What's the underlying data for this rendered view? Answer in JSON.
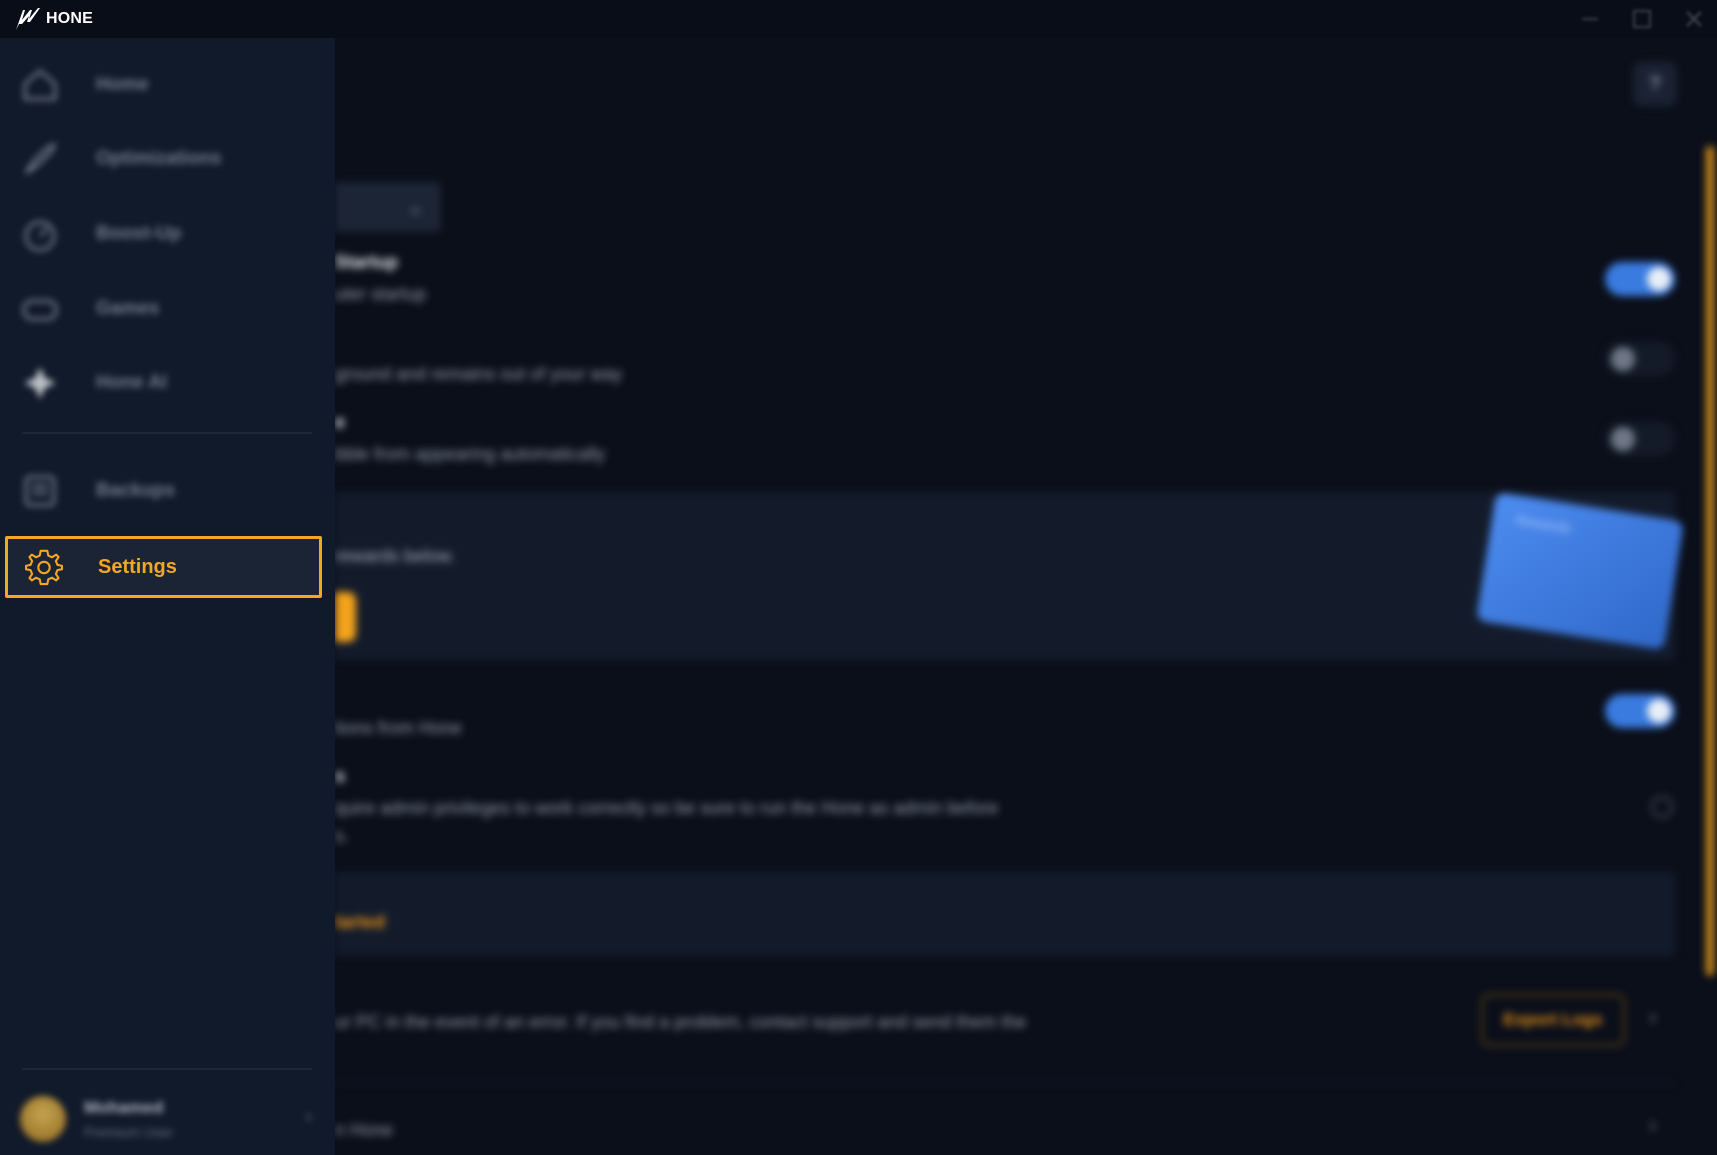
{
  "app": {
    "name": "HONE"
  },
  "sidebar": {
    "items": [
      {
        "label": "Home",
        "icon": "home-icon"
      },
      {
        "label": "Optimizations",
        "icon": "rocket-icon"
      },
      {
        "label": "Boost-Up",
        "icon": "speedometer-icon"
      },
      {
        "label": "Games",
        "icon": "gamepad-icon"
      },
      {
        "label": "Hone AI",
        "icon": "sparkle-icon"
      },
      {
        "label": "Backups",
        "icon": "backups-icon"
      }
    ],
    "active": {
      "label": "Settings",
      "icon": "gear-icon"
    },
    "user": {
      "name": "Mohamed",
      "role": "Premium User"
    }
  },
  "main": {
    "startup_title": "Startup",
    "startup_desc": "uter startup",
    "background_desc": "ground and remains out of your way",
    "bubble_title": "e",
    "bubble_desc": "bble from appearing automatically",
    "rewards_desc": "rewards below.",
    "rewards_card_label": "Rewards",
    "notify_desc": "tions from Hone",
    "admin_title": "s",
    "admin_desc": "quire admin privileges to work correctly so be sure to run the Hone as admin before",
    "admin_desc2": "s.",
    "orange_text": "tarted",
    "logs_desc": "ur PC in the event of an error. If you find a problem, contact support and send them the",
    "export_label": "Export Logs",
    "last_desc": "n Hone"
  },
  "colors": {
    "accent": "#f5a623",
    "toggle_on": "#3a7be0",
    "sidebar_bg": "#111a2a",
    "main_bg": "#0b0f1a"
  }
}
